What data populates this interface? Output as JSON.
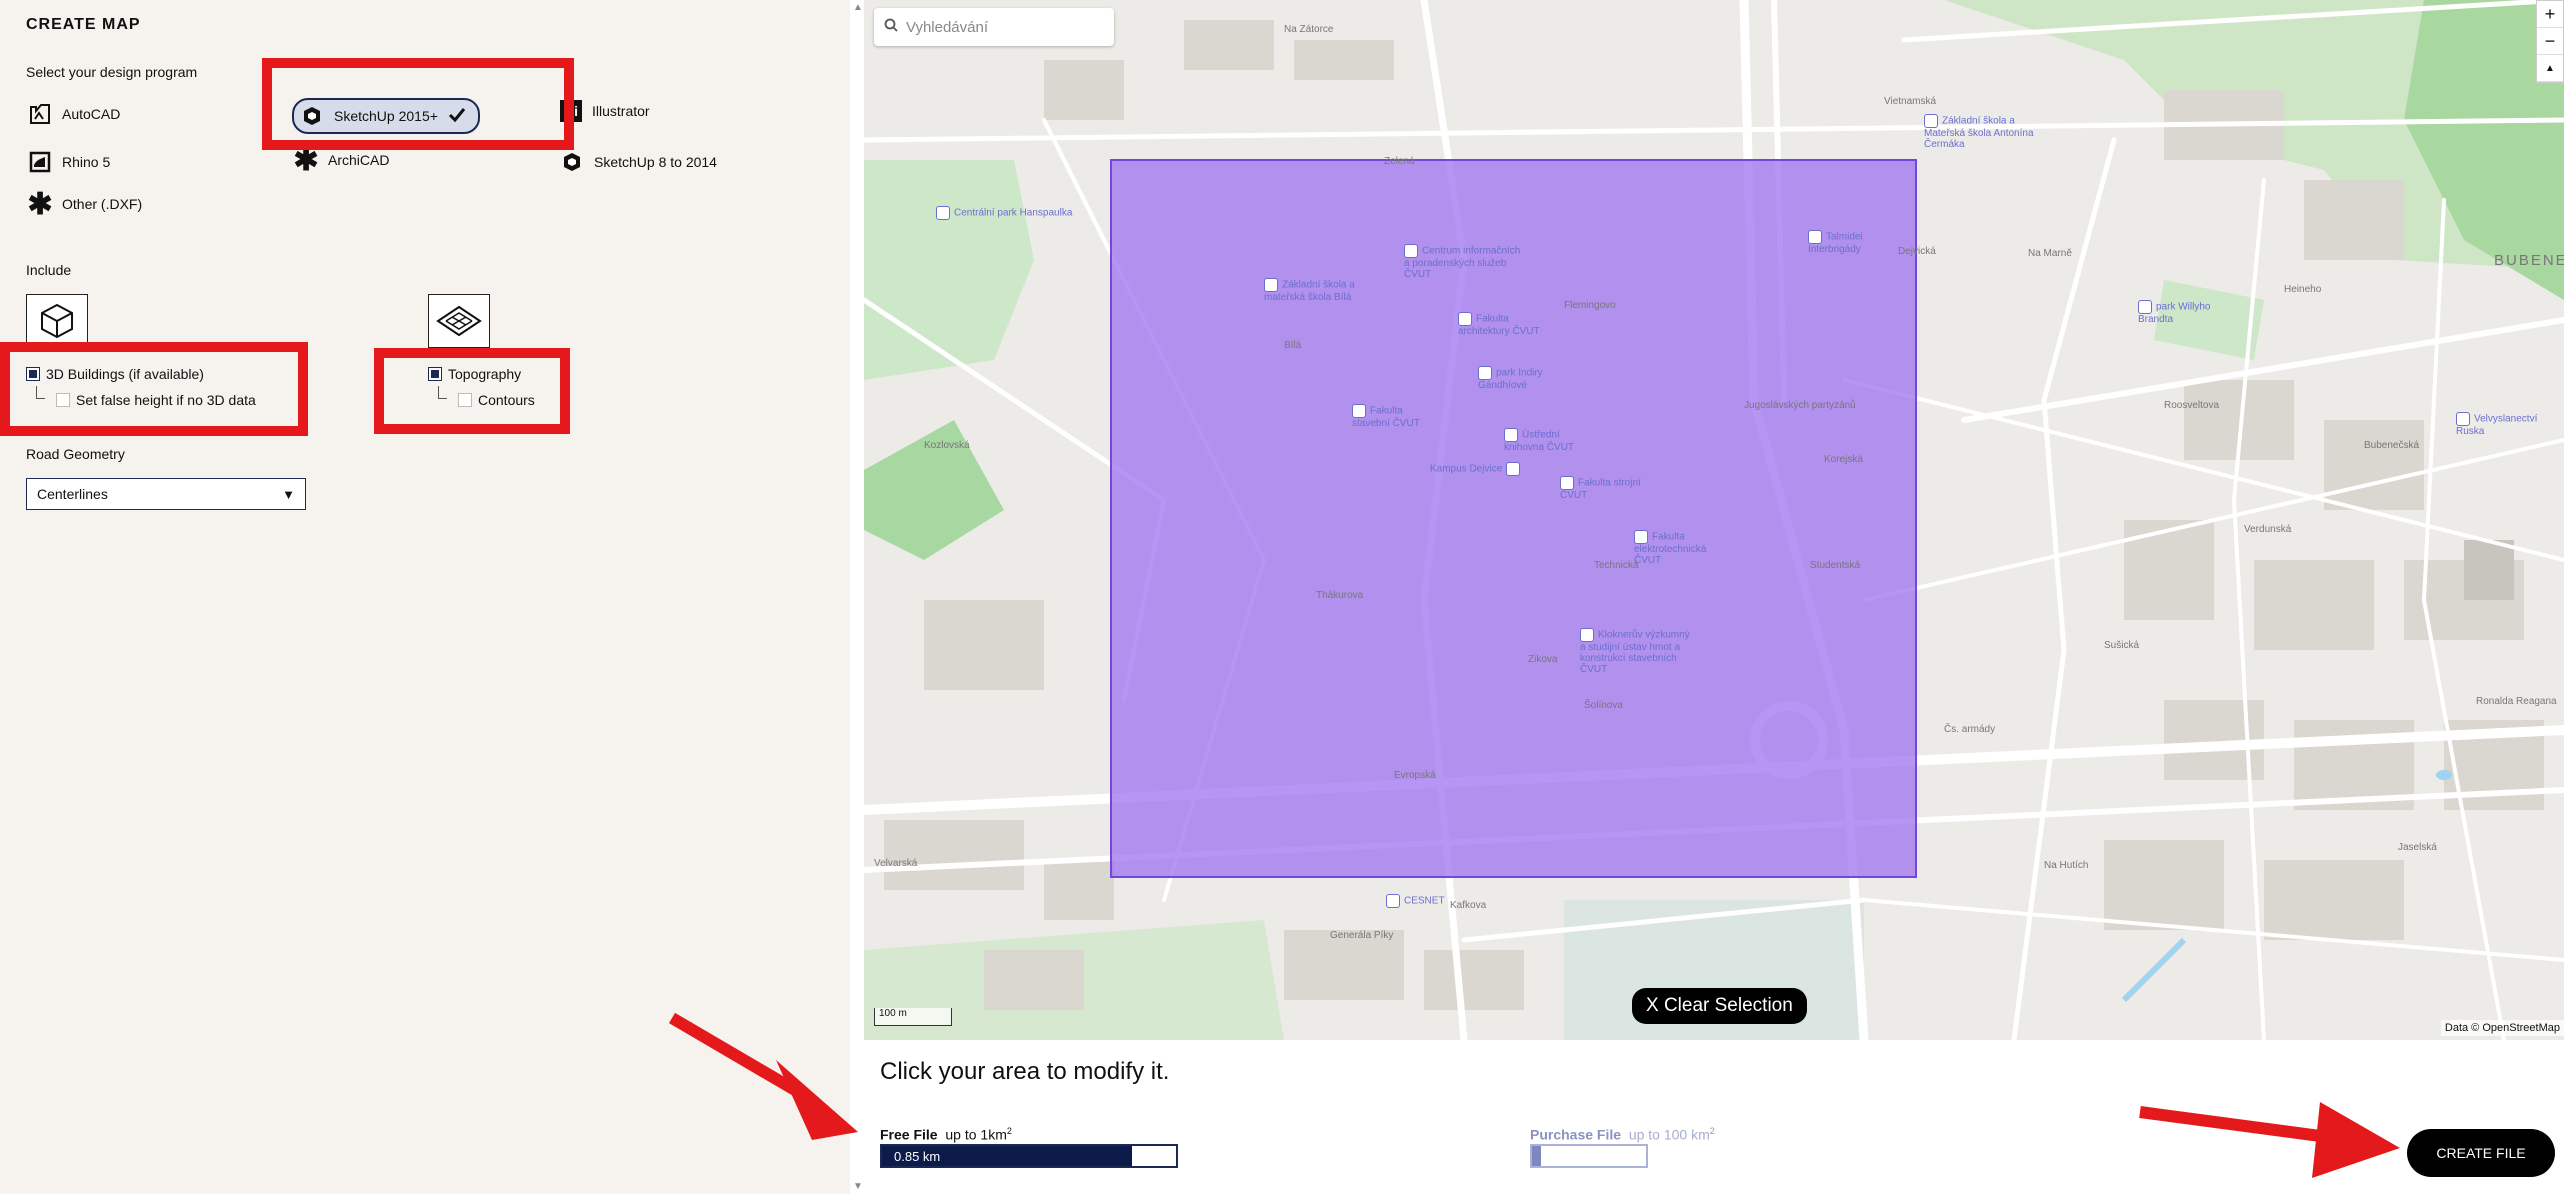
{
  "left": {
    "title": "CREATE MAP",
    "design_prompt": "Select your design program",
    "programs": [
      {
        "label": "AutoCAD",
        "icon": "autocad-icon"
      },
      {
        "label": "SketchUp 2015+",
        "icon": "sketchup-icon",
        "selected": true
      },
      {
        "label": "Illustrator",
        "icon": "illustrator-icon"
      },
      {
        "label": "Rhino 5",
        "icon": "rhino-icon"
      },
      {
        "label": "ArchiCAD",
        "icon": "archicad-icon"
      },
      {
        "label": "SketchUp 8 to 2014",
        "icon": "sketchup-icon"
      },
      {
        "label": "Other (.DXF)",
        "icon": "asterisk-icon"
      }
    ],
    "include_label": "Include",
    "buildings_label": "3D Buildings (if available)",
    "false_height_label": "Set false height if no 3D data",
    "topography_label": "Topography",
    "contours_label": "Contours",
    "road_geometry_label": "Road Geometry",
    "road_geometry_value": "Centerlines",
    "illustrator_glyph": "Ai"
  },
  "map": {
    "search_placeholder": "Vyhledávání",
    "zoom_in": "+",
    "zoom_out": "−",
    "compass": "▲",
    "scale_label": "100 m",
    "attribution": "Data © OpenStreetMap",
    "clear_selection": "X Clear Selection",
    "selection_color": "#9b6cf0",
    "pois": [
      "Centrální park Hanspaulka",
      "Centrum informačních a poradenských služeb ČVUT",
      "Základní škola a mateřská škola Bílá",
      "Fakulta architektury ČVUT",
      "park Indiry Gándhíové",
      "Fakulta stavební ČVUT",
      "Ústřední knihovna ČVUT",
      "Kampus Dejvice",
      "Fakulta strojní ČVUT",
      "Fakulta elektrotechnická ČVUT",
      "Kloknerův výzkumný a studijní ústav hmot a konstrukcí stavebních ČVUT",
      "Základní škola a Mateřská škola Antonína Čermáka",
      "Talmidei Interbrigády",
      "park Willyho Brandta",
      "Velvyslanectví Ruska",
      "CESNET"
    ],
    "streets": [
      "Zelená",
      "Evropská",
      "Velvarská",
      "Kafkova",
      "Generála Píky",
      "Bílá",
      "Jugoslávských partyzánů",
      "Technická",
      "Zikova",
      "Šolínova",
      "Thákurova",
      "Flemingovo",
      "Kozlovská",
      "Verdunská",
      "Sušická",
      "Na Marně",
      "Čs. armády",
      "Ronalda Reagana",
      "Jaselská",
      "Na Hutích",
      "Roosveltova",
      "BUBENEČ",
      "Vietnamská",
      "Na Zátorce",
      "Dejvická",
      "Heineho",
      "Korejská",
      "Bubenečská",
      "Studentská"
    ]
  },
  "bottom": {
    "instruction": "Click your area to modify it.",
    "free_file_label": "Free File",
    "free_file_limit": "up to 1km",
    "free_file_sup": "2",
    "free_value_label": "0.85 km",
    "free_progress_fraction": 0.85,
    "purchase_file_label": "Purchase File",
    "purchase_file_limit": "up to 100 km",
    "purchase_file_sup": "2",
    "purchase_progress_fraction": 0.08,
    "create_file": "CREATE FILE"
  }
}
